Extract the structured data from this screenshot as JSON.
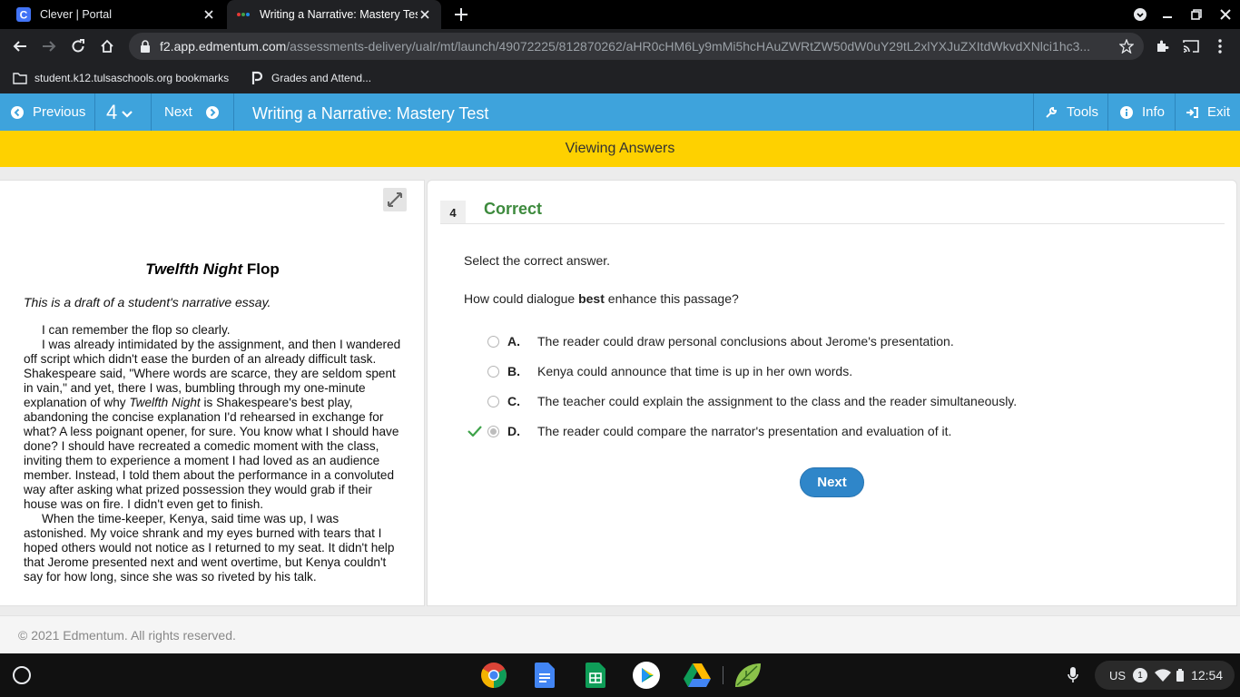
{
  "browser": {
    "tabs": [
      {
        "title": "Clever | Portal",
        "favicon_letter": "C"
      },
      {
        "title": "Writing a Narrative: Mastery Test"
      }
    ],
    "url_host": "f2.app.edmentum.com",
    "url_path": "/assessments-delivery/ualr/mt/launch/49072225/812870262/aHR0cHM6Ly9mMi5hcHAuZWRtZW50dW0uY29tL2xlYXJuZXItdWkvdXNlci1hc3...",
    "bookmarks": [
      {
        "label": "student.k12.tulsaschools.org bookmarks"
      },
      {
        "label": "Grades and Attend..."
      }
    ]
  },
  "header": {
    "previous_label": "Previous",
    "question_number": "4",
    "next_label": "Next",
    "title": "Writing a Narrative: Mastery Test",
    "tools_label": "Tools",
    "info_label": "Info",
    "exit_label": "Exit"
  },
  "banner": {
    "text": "Viewing Answers"
  },
  "passage": {
    "title_italic": "Twelfth Night",
    "title_rest": " Flop",
    "intro": "This is a draft of a student's narrative essay.",
    "p1": "I can remember the flop so clearly.",
    "p2_a": "I was already intimidated by the assignment, and then I wandered off script which didn't ease the burden of an already difficult task. Shakespeare said, \"Where words are scarce, they are seldom spent in vain,\" and yet, there I was, bumbling through my one-minute explanation of why ",
    "p2_italic": "Twelfth Night",
    "p2_b": " is Shakespeare's best play, abandoning the concise explanation I'd rehearsed in exchange for what? A less poignant opener, for sure. You know what I should have done? I should have recreated a comedic moment with the class, inviting them to experience a moment I had loved as an audience member. Instead, I told them about the performance in a convoluted way after asking what prized possession they would grab if their house was on fire. I didn't even get to finish.",
    "p3": "When the time-keeper, Kenya, said time was up, I was astonished. My voice shrank and my eyes burned with tears that I hoped others would not notice as I returned to my seat. It didn't help that Jerome presented next and went overtime, but Kenya couldn't say for how long, since she was so riveted by his talk."
  },
  "question": {
    "number": "4",
    "status": "Correct",
    "instruction": "Select the correct answer.",
    "text_before": "How could dialogue ",
    "text_bold": "best",
    "text_after": " enhance this passage?",
    "options": [
      {
        "letter": "A.",
        "text": "The reader could draw personal conclusions about Jerome's presentation."
      },
      {
        "letter": "B.",
        "text": "Kenya could announce that time is up in her own words."
      },
      {
        "letter": "C.",
        "text": "The teacher could explain the assignment to the class and the reader simultaneously."
      },
      {
        "letter": "D.",
        "text": "The reader could compare the narrator's presentation and evaluation of it."
      }
    ],
    "selected_option": "D.",
    "next_label": "Next"
  },
  "footer": {
    "text": "© 2021 Edmentum. All rights reserved."
  },
  "shelf": {
    "input_method": "US",
    "notification_count": "1",
    "time": "12:54"
  },
  "colors": {
    "header_blue": "#3ea3dc",
    "banner_yellow": "#fed100",
    "correct_green": "#3d8a3d",
    "button_blue": "#2f86c9"
  }
}
